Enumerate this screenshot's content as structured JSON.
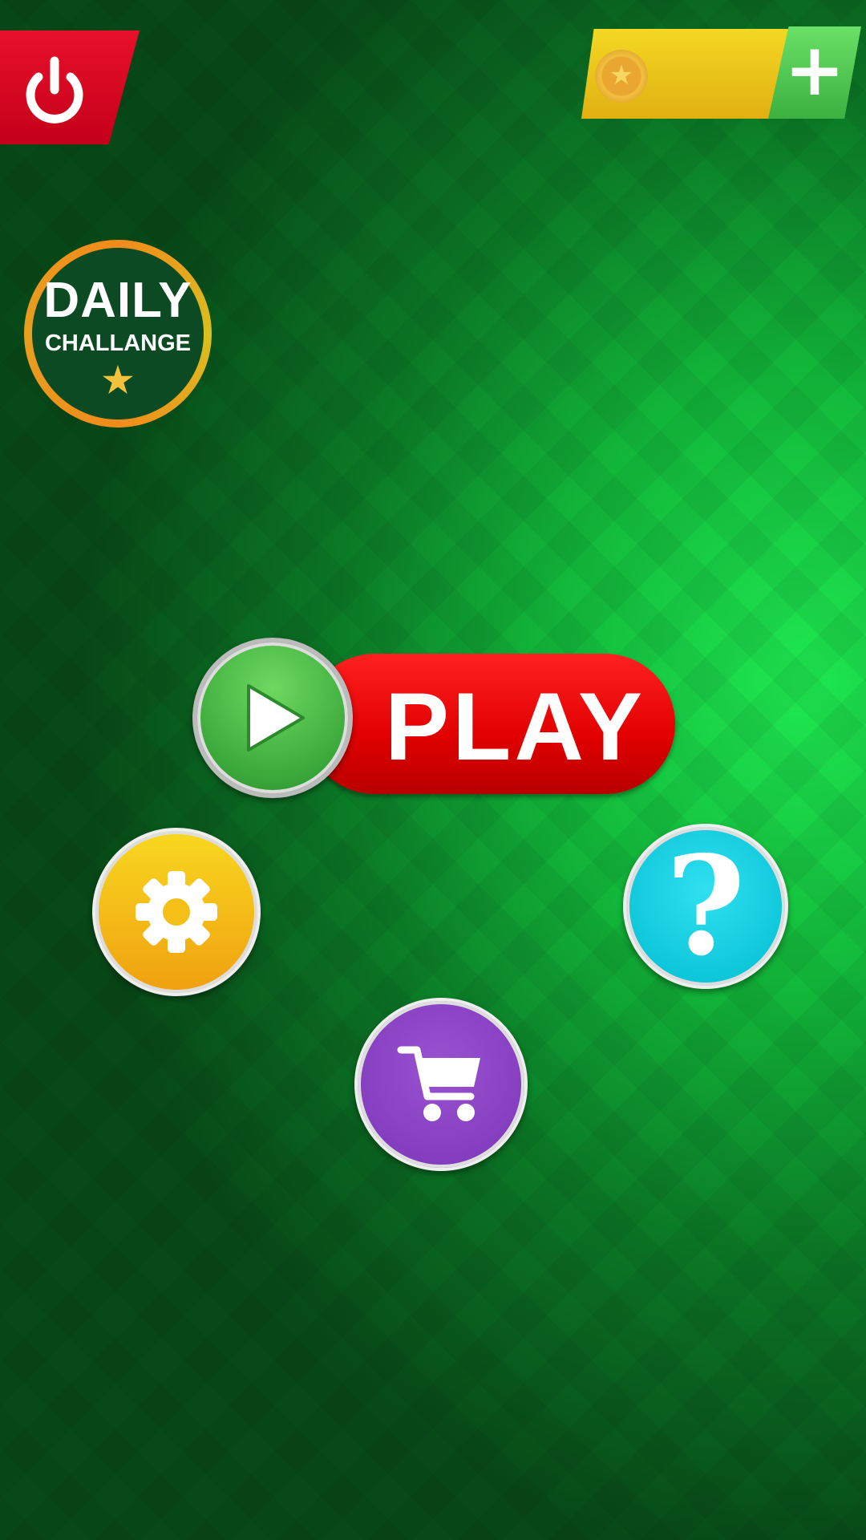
{
  "coins": {
    "value": "",
    "add_label": "+"
  },
  "daily": {
    "line1": "DAILY",
    "line2": "CHALLANGE",
    "badge": "★"
  },
  "play": {
    "label": "PLAY"
  },
  "help": {
    "label": "?"
  },
  "colors": {
    "power": "#d0001c",
    "coin_bar": "#f0cc1c",
    "play": "#e80000",
    "settings": "#f4c018",
    "help": "#00c8dc",
    "shop": "#8440c0"
  }
}
